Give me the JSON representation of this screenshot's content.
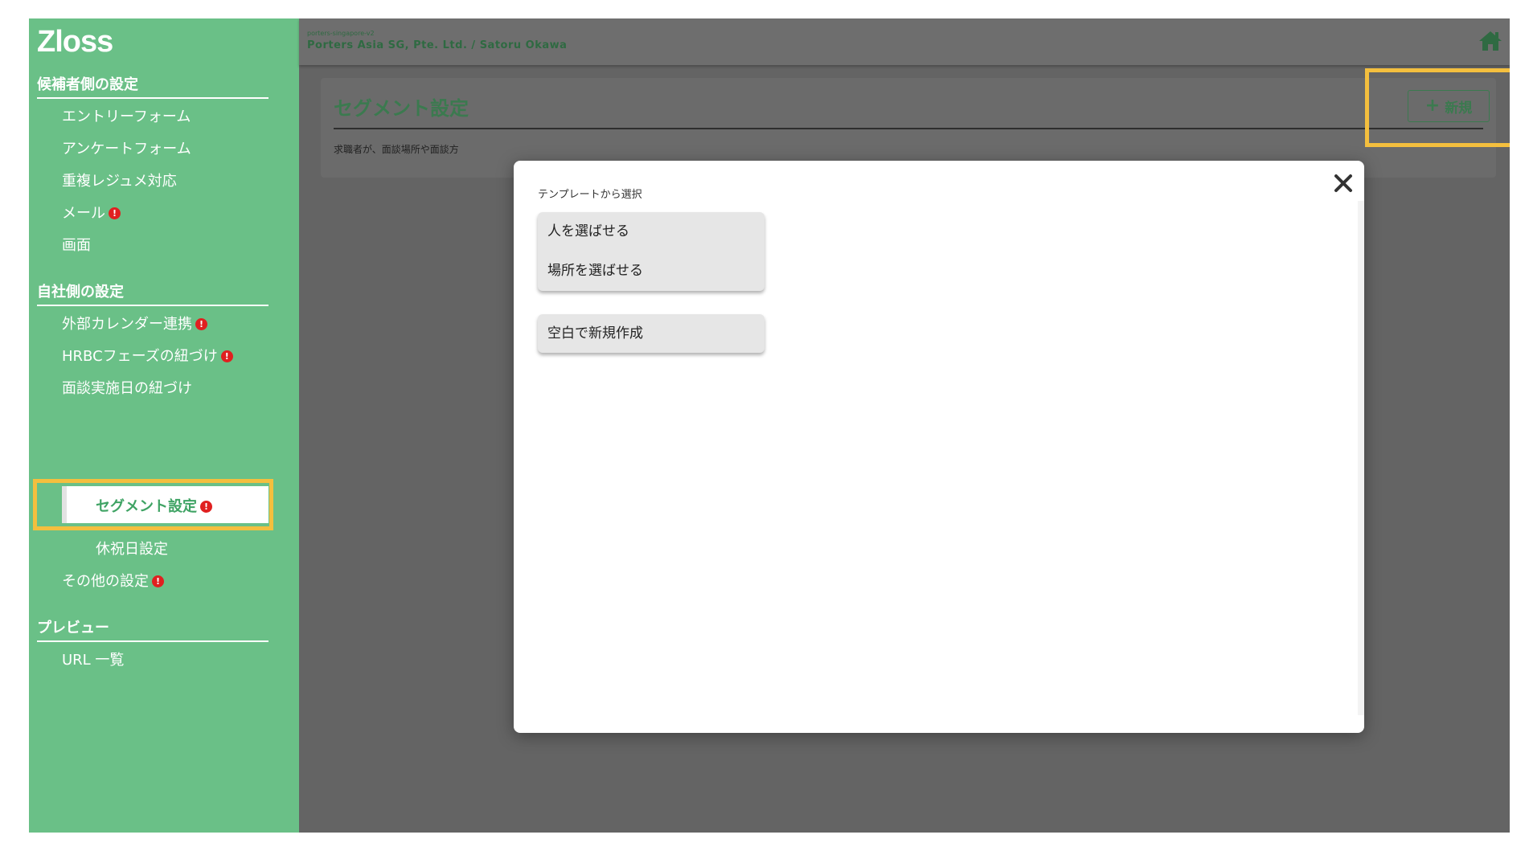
{
  "sidebar": {
    "logo": "Zloss",
    "sections": [
      {
        "title": "候補者側の設定"
      },
      {
        "title": "自社側の設定"
      },
      {
        "title": "プレビュー"
      }
    ],
    "items": {
      "entry_form": "エントリーフォーム",
      "survey_form": "アンケートフォーム",
      "duplicate_resume": "重複レジュメ対応",
      "mail": "メール",
      "screen": "画面",
      "external_calendar": "外部カレンダー連携",
      "hrbc_phase": "HRBCフェーズの紐づけ",
      "interview_date": "面談実施日の紐づけ",
      "segment": "セグメント設定",
      "holiday": "休祝日設定",
      "other": "その他の設定",
      "url_list": "URL 一覧"
    },
    "alert_glyph": "!"
  },
  "header": {
    "tenant": "porters-singapore-v2",
    "company_user": "Porters Asia SG, Pte. Ltd. / Satoru Okawa",
    "home_icon": "home-icon"
  },
  "page": {
    "title": "セグメント設定",
    "description": "求職者が、面談場所や面談方",
    "new_button": {
      "icon": "+",
      "label": "新規"
    }
  },
  "modal": {
    "label": "テンプレートから選択",
    "templates": [
      "人を選ばせる",
      "場所を選ばせる"
    ],
    "blank_option": "空白で新規作成",
    "close_icon": "close-icon"
  },
  "colors": {
    "sidebar": "#6ac087",
    "overlay": "#646464",
    "accent_green": "#3b7a4f",
    "highlight": "#f4bf3e",
    "alert": "#e02020"
  }
}
